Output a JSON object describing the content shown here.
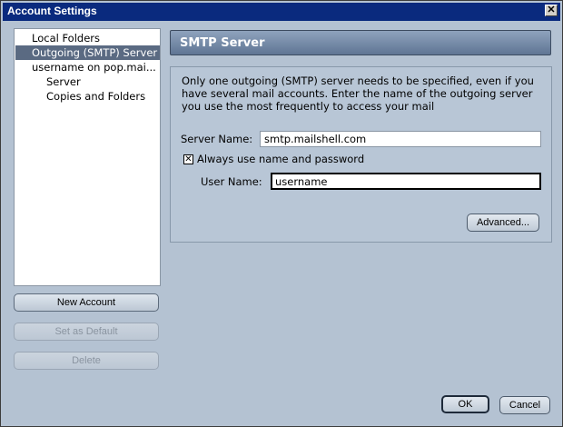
{
  "window": {
    "title": "Account Settings",
    "close_glyph": "✕"
  },
  "tree": {
    "items": [
      {
        "label": "Local Folders"
      },
      {
        "label": "Outgoing (SMTP) Server"
      },
      {
        "label": "username on pop.mai..."
      },
      {
        "label": "Server"
      },
      {
        "label": "Copies and Folders"
      }
    ]
  },
  "sidebar_buttons": {
    "new_account": "New Account",
    "set_default": "Set as Default",
    "delete": "Delete"
  },
  "panel": {
    "title": "SMTP Server",
    "description": "Only one outgoing (SMTP) server needs to be specified, even if you have several mail accounts. Enter the name of the outgoing server you use the most frequently to access your mail",
    "server_name_label": "Server Name:",
    "server_name_value": "smtp.mailshell.com",
    "auth_checkbox_label": "Always use name and password",
    "auth_checkbox_checked": true,
    "auth_checkbox_glyph": "✕",
    "user_name_label": "User Name:",
    "user_name_value": "username",
    "advanced_button": "Advanced..."
  },
  "footer": {
    "ok": "OK",
    "cancel": "Cancel"
  }
}
